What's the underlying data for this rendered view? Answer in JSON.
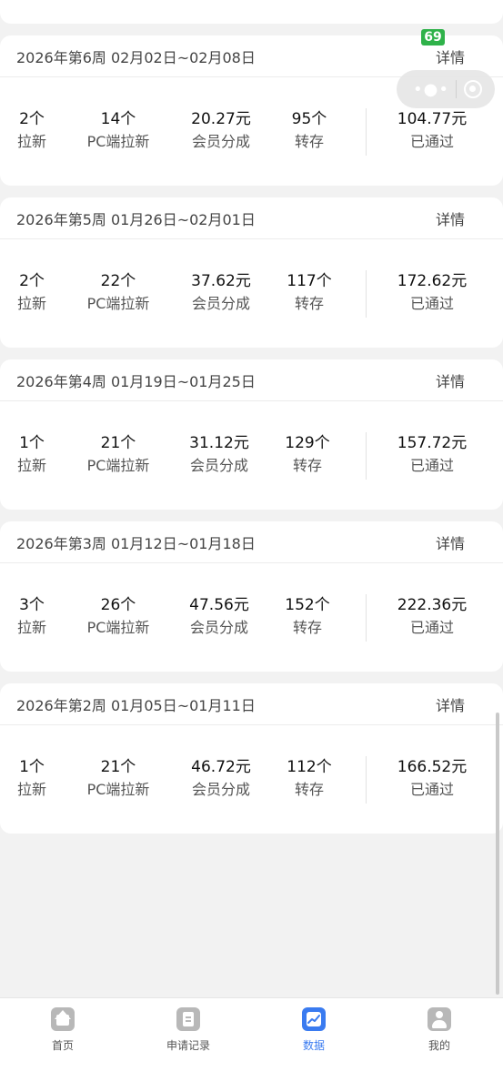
{
  "overlay": {
    "badge": "69"
  },
  "weeks": [
    {
      "title": "2026年第6周 02月02日~02月08日",
      "detail": "详情",
      "stats": [
        {
          "value": "2个",
          "label": "拉新"
        },
        {
          "value": "14个",
          "label": "PC端拉新"
        },
        {
          "value": "20.27元",
          "label": "会员分成"
        },
        {
          "value": "95个",
          "label": "转存"
        },
        {
          "value": "104.77元",
          "label": "已通过"
        }
      ]
    },
    {
      "title": "2026年第5周 01月26日~02月01日",
      "detail": "详情",
      "stats": [
        {
          "value": "2个",
          "label": "拉新"
        },
        {
          "value": "22个",
          "label": "PC端拉新"
        },
        {
          "value": "37.62元",
          "label": "会员分成"
        },
        {
          "value": "117个",
          "label": "转存"
        },
        {
          "value": "172.62元",
          "label": "已通过"
        }
      ]
    },
    {
      "title": "2026年第4周 01月19日~01月25日",
      "detail": "详情",
      "stats": [
        {
          "value": "1个",
          "label": "拉新"
        },
        {
          "value": "21个",
          "label": "PC端拉新"
        },
        {
          "value": "31.12元",
          "label": "会员分成"
        },
        {
          "value": "129个",
          "label": "转存"
        },
        {
          "value": "157.72元",
          "label": "已通过"
        }
      ]
    },
    {
      "title": "2026年第3周 01月12日~01月18日",
      "detail": "详情",
      "stats": [
        {
          "value": "3个",
          "label": "拉新"
        },
        {
          "value": "26个",
          "label": "PC端拉新"
        },
        {
          "value": "47.56元",
          "label": "会员分成"
        },
        {
          "value": "152个",
          "label": "转存"
        },
        {
          "value": "222.36元",
          "label": "已通过"
        }
      ]
    },
    {
      "title": "2026年第2周 01月05日~01月11日",
      "detail": "详情",
      "stats": [
        {
          "value": "1个",
          "label": "拉新"
        },
        {
          "value": "21个",
          "label": "PC端拉新"
        },
        {
          "value": "46.72元",
          "label": "会员分成"
        },
        {
          "value": "112个",
          "label": "转存"
        },
        {
          "value": "166.52元",
          "label": "已通过"
        }
      ]
    }
  ],
  "tabbar": {
    "active": "tab-data",
    "accent": "#3a7bf0",
    "items": [
      {
        "label": "首页",
        "icon": "home-icon"
      },
      {
        "label": "申请记录",
        "icon": "document-icon"
      },
      {
        "label": "数据",
        "icon": "chart-icon"
      },
      {
        "label": "我的",
        "icon": "user-icon"
      }
    ]
  }
}
